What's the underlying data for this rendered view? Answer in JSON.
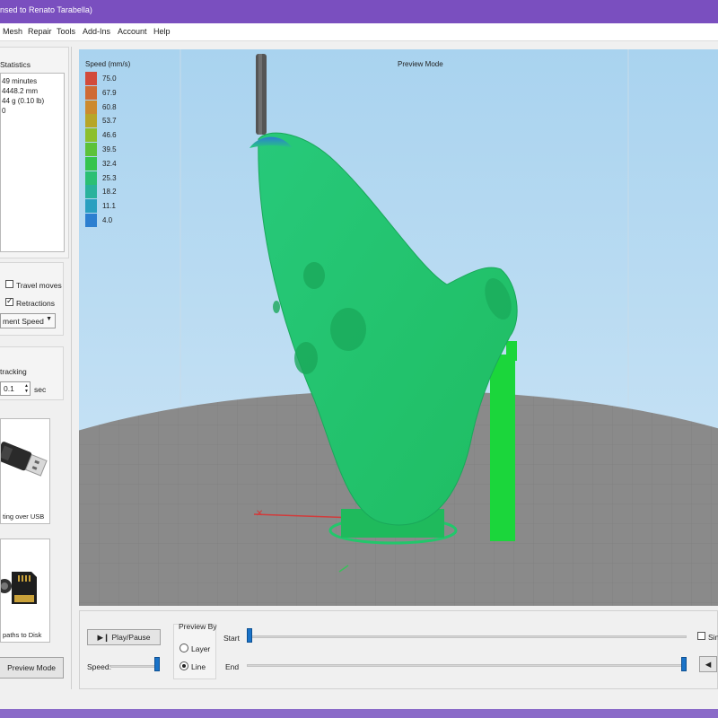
{
  "titlebar": {
    "text": "nsed to Renato Tarabella)"
  },
  "menu": {
    "items": [
      "Mesh",
      "Repair",
      "Tools",
      "Add-Ins",
      "Account",
      "Help"
    ]
  },
  "statistics": {
    "header": "Statistics",
    "lines": [
      "49 minutes",
      "4448.2 mm",
      "44 g (0.10 lb)",
      "0"
    ]
  },
  "options": {
    "travel_moves": "Travel moves",
    "retractions": "Retractions",
    "travel_checked": false,
    "retractions_checked": true,
    "color_by": "ment Speed"
  },
  "tracking": {
    "label": "tracking",
    "value": "0.1",
    "unit": "sec"
  },
  "usb_tile": {
    "caption": "ting over USB"
  },
  "disk_tile": {
    "caption": "paths to Disk"
  },
  "preview_button": {
    "label": "Preview Mode"
  },
  "viewport": {
    "mode_label": "Preview Mode",
    "legend_title": "Speed (mm/s)",
    "legend": [
      {
        "value": "75.0",
        "color": "#d24a3a"
      },
      {
        "value": "67.9",
        "color": "#cf6a34"
      },
      {
        "value": "60.8",
        "color": "#cc8a2e"
      },
      {
        "value": "53.7",
        "color": "#b7a628"
      },
      {
        "value": "46.6",
        "color": "#8cbf2e"
      },
      {
        "value": "39.5",
        "color": "#5cc23a"
      },
      {
        "value": "32.4",
        "color": "#34c44e"
      },
      {
        "value": "25.3",
        "color": "#2bbf74"
      },
      {
        "value": "18.2",
        "color": "#2ab29c"
      },
      {
        "value": "11.1",
        "color": "#2a9fc0"
      },
      {
        "value": "4.0",
        "color": "#2c7fd0"
      }
    ]
  },
  "controls": {
    "play_pause": "Play/Pause",
    "speed_label": "Speed:",
    "preview_by": "Preview By",
    "layer": "Layer",
    "line": "Line",
    "line_selected": true,
    "start": "Start",
    "end": "End",
    "single": "Sing"
  }
}
